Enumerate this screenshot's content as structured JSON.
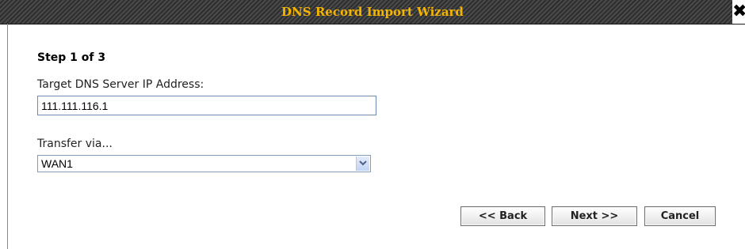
{
  "window": {
    "title": "DNS Record Import Wizard",
    "close_glyph": "✖",
    "close_icon": "close-icon"
  },
  "wizard": {
    "step_label": "Step 1 of 3",
    "ip_field": {
      "label": "Target DNS Server IP Address:",
      "value": "111.111.116.1"
    },
    "transfer": {
      "label": "Transfer via...",
      "selected": "WAN1",
      "arrow_icon": "chevron-down-icon"
    },
    "buttons": {
      "back": "<< Back",
      "next": "Next >>",
      "cancel": "Cancel"
    }
  },
  "colors": {
    "title_text": "#f5b400",
    "title_bar": "#3c3c3c",
    "input_border": "#6d8cb4"
  }
}
